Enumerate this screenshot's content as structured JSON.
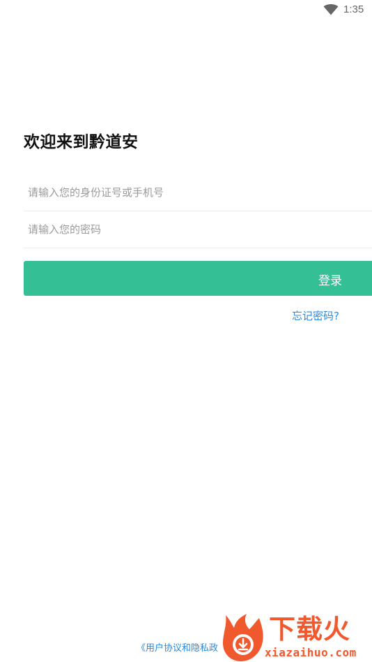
{
  "status_bar": {
    "time": "1:35",
    "wifi_icon": "wifi-icon"
  },
  "title": "欢迎来到黔道安",
  "form": {
    "username_placeholder": "请输入您的身份证号或手机号",
    "password_placeholder": "请输入您的密码",
    "login_label": "登录",
    "forgot_label": "忘记密码?"
  },
  "footer": {
    "agreement_text": "《用户协议和隐私政"
  },
  "watermark": {
    "brand": "下载火",
    "domain": "xiazaihuo.com",
    "logo_icon": "flame-download-icon"
  },
  "colors": {
    "primary": "#34bf95",
    "link": "#2e88d8",
    "watermark": "#f0582e"
  }
}
